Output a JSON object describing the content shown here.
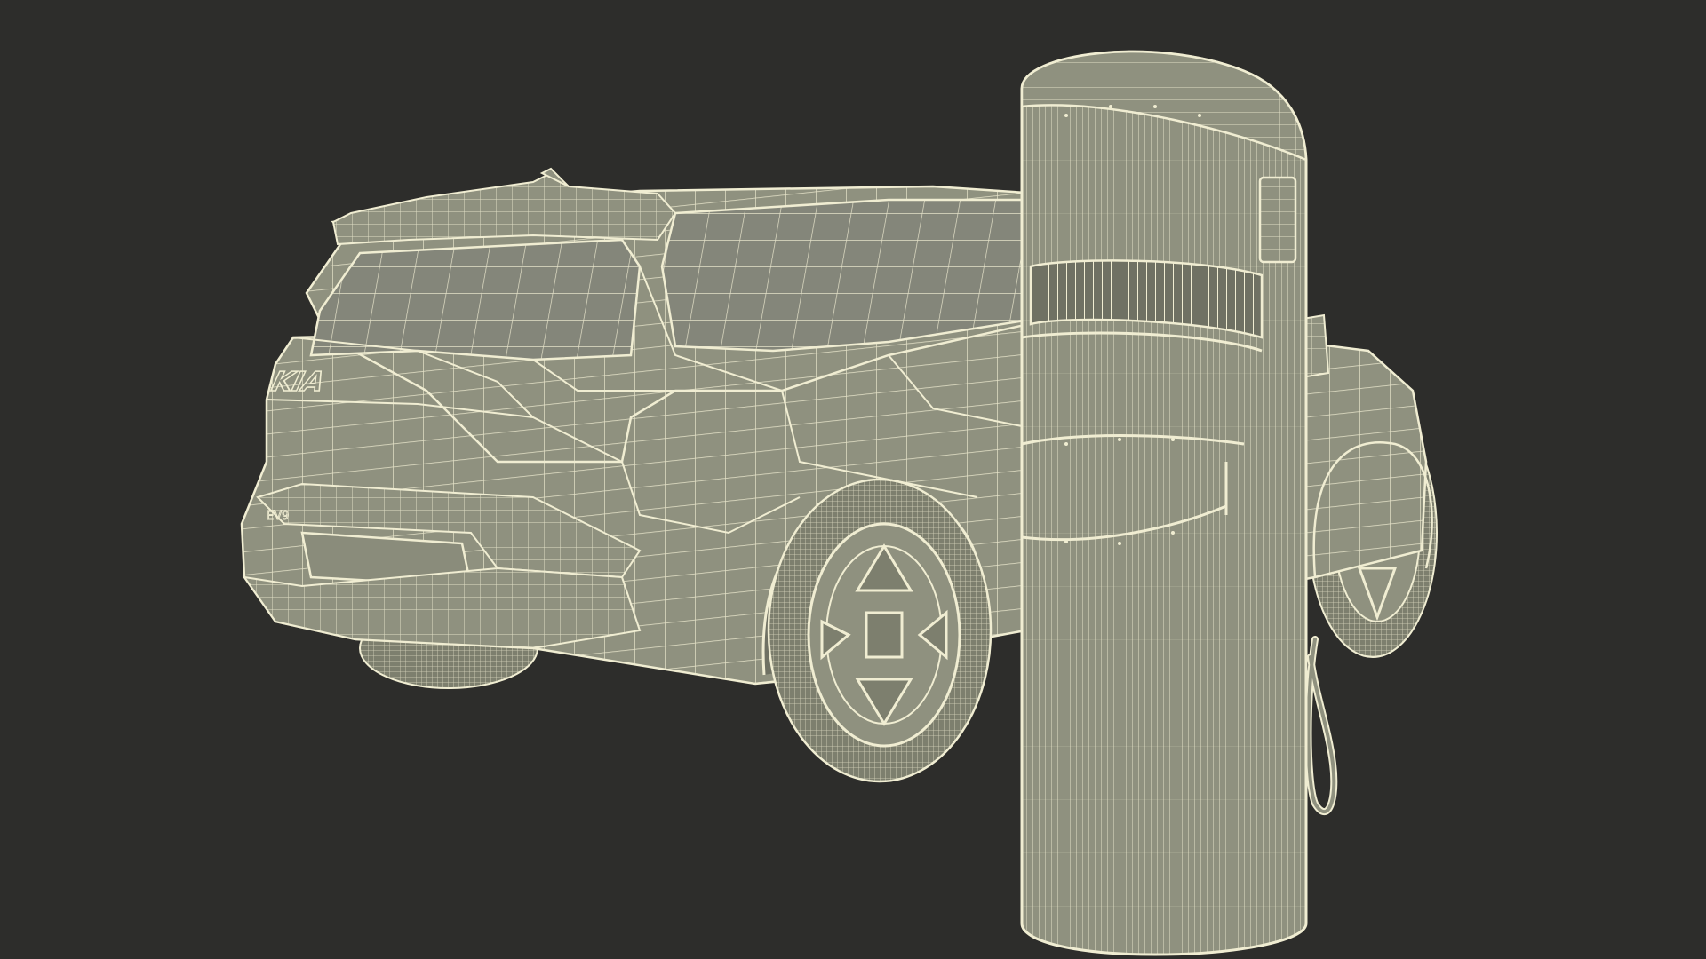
{
  "scene": {
    "background_color": "#2d2d2b",
    "mesh_fill_color": "#8f917f",
    "mesh_line_color": "#f0edd2",
    "wheel_fill_color": "#7d7f6e"
  },
  "vehicle": {
    "badge_text": "KIA",
    "model_badge_text": "EV9"
  },
  "objects": [
    {
      "name": "suv",
      "icon": "car-wireframe"
    },
    {
      "name": "charging-station",
      "icon": "ev-charger-wireframe"
    }
  ]
}
